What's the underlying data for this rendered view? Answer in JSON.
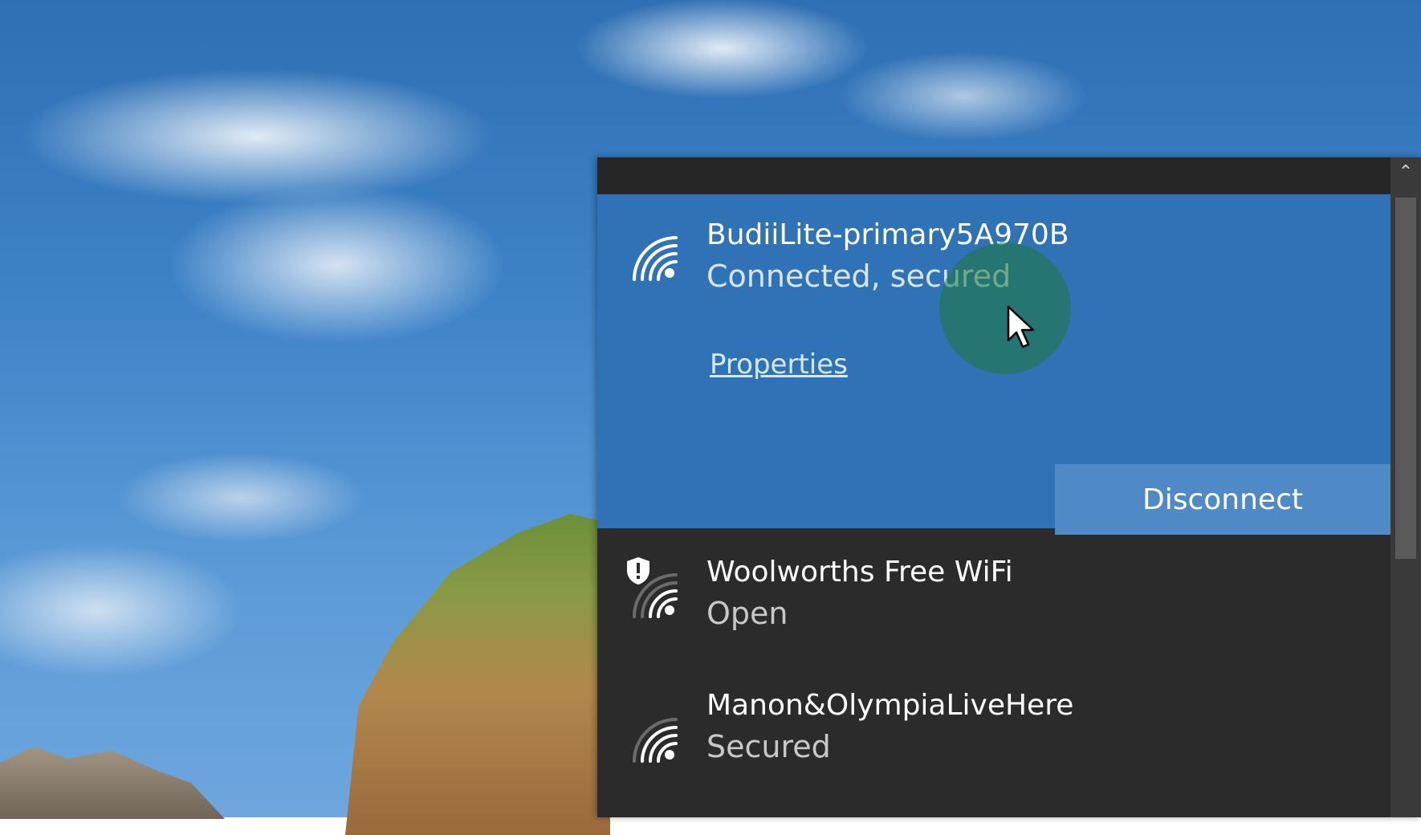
{
  "connected_network": {
    "name": "BudiiLite-primary5A970B",
    "status": "Connected, secured",
    "properties_label": "Properties",
    "disconnect_label": "Disconnect"
  },
  "networks": [
    {
      "name": "Woolworths Free WiFi",
      "status": "Open",
      "icon": "wifi-icon",
      "badge": "shield-warning-icon"
    },
    {
      "name": "Manon&OlympiaLiveHere",
      "status": "Secured",
      "icon": "wifi-icon"
    }
  ],
  "icons": {
    "scroll_up": "chevron-up-icon",
    "cursor": "mouse-pointer-icon"
  },
  "colors": {
    "connected_bg": "#2f73b6",
    "flyout_bg": "#2b2b2b",
    "button_bg": "#4f8ac7",
    "click_indicator": "#1e783c"
  }
}
